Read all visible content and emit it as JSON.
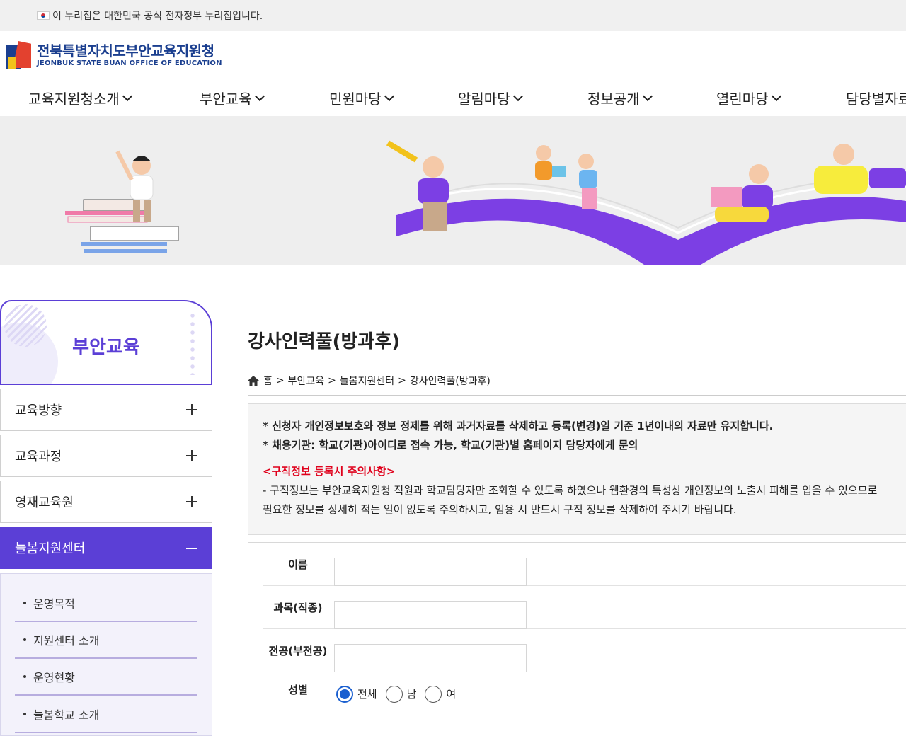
{
  "gov_banner": {
    "text": "이 누리집은 대한민국 공식 전자정부 누리집입니다."
  },
  "logo": {
    "name_ko": "전북특별자치도부안교육지원청",
    "name_en": "JEONBUK STATE BUAN OFFICE OF EDUCATION"
  },
  "gnb": [
    {
      "label": "교육지원청소개"
    },
    {
      "label": "부안교육"
    },
    {
      "label": "민원마당"
    },
    {
      "label": "알림마당"
    },
    {
      "label": "정보공개"
    },
    {
      "label": "열린마당"
    },
    {
      "label": "담당별자료"
    }
  ],
  "side": {
    "title": "부안교육",
    "menus": [
      {
        "label": "교육방향"
      },
      {
        "label": "교육과정"
      },
      {
        "label": "영재교육원"
      },
      {
        "label": "늘봄지원센터"
      }
    ],
    "sub_items": [
      {
        "label": "운영목적"
      },
      {
        "label": "지원센터 소개"
      },
      {
        "label": "운영현황"
      },
      {
        "label": "늘봄학교 소개"
      }
    ]
  },
  "content": {
    "title": "강사인력풀(방과후)",
    "breadcrumb": [
      "홈",
      "부안교육",
      "늘봄지원센터",
      "강사인력풀(방과후)"
    ],
    "notice": {
      "line1": "* 신청자 개인정보보호와 정보 정제를 위해 과거자료를 삭제하고 등록(변경)일 기준 1년이내의 자료만 유지합니다.",
      "line2": "* 채용기관: 학교(기관)아이디로 접속 가능, 학교(기관)별 홈페이지 담당자에게 문의",
      "warn_title": "<구직정보 등록시 주의사항>",
      "body1": "- 구직정보는 부안교육지원청 직원과 학교담당자만 조회할 수 있도록 하였으나 웹환경의 특성상 개인정보의 노출시 피해를 입을 수 있으므로",
      "body2": "필요한 정보를 상세히 적는 일이 없도록 주의하시고, 임용 시 반드시 구직 정보를 삭제하여 주시기 바랍니다."
    },
    "form": {
      "name_label": "이름",
      "subject_label": "과목(직종)",
      "major_label": "전공(부전공)",
      "gender_label": "성별",
      "gender_options": [
        "전체",
        "남",
        "여"
      ],
      "gender_selected": "전체"
    }
  },
  "colors": {
    "accent": "#5b3fd6",
    "warn": "#e0001b",
    "radio": "#1a5fd0"
  }
}
